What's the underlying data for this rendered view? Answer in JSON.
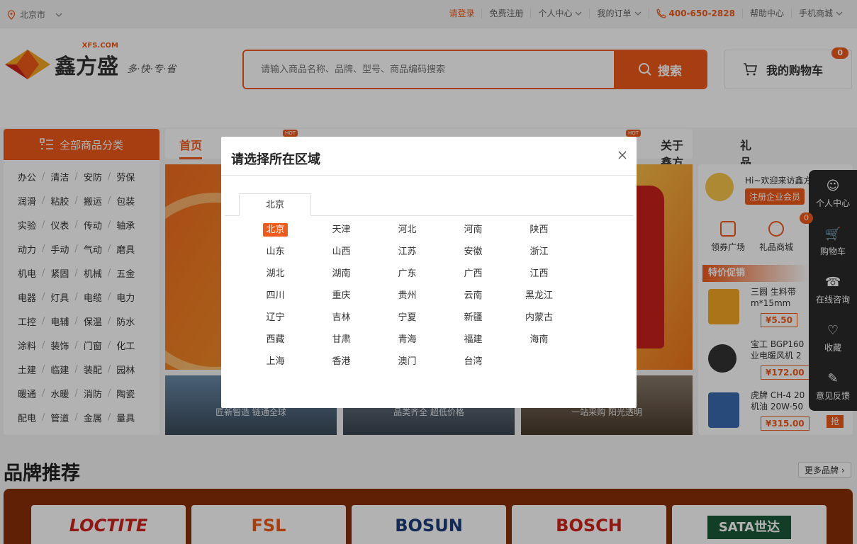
{
  "topbar": {
    "location": "北京市",
    "login": "请登录",
    "register": "免费注册",
    "user_center": "个人中心",
    "my_orders": "我的订单",
    "phone": "400-650-2828",
    "help": "帮助中心",
    "mobile": "手机商城"
  },
  "header": {
    "logo_text": "鑫方盛",
    "logo_domain": "XFS.COM",
    "slogan": "多·快·专·省",
    "search_placeholder": "请输入商品名称、品牌、型号、商品编码搜索",
    "search_button": "搜索",
    "cart_label": "我的购物车",
    "cart_count": "0"
  },
  "nav": {
    "all_categories": "全部商品分类",
    "home": "首页",
    "about": "关于鑫方盛",
    "gift": "礼品商城",
    "hot": "HOT"
  },
  "categories": [
    [
      "办公",
      "清洁",
      "安防",
      "劳保"
    ],
    [
      "润滑",
      "粘胶",
      "搬运",
      "包装"
    ],
    [
      "实验",
      "仪表",
      "传动",
      "轴承"
    ],
    [
      "动力",
      "手动",
      "气动",
      "磨具"
    ],
    [
      "机电",
      "紧固",
      "机械",
      "五金"
    ],
    [
      "电器",
      "灯具",
      "电缆",
      "电力"
    ],
    [
      "工控",
      "电辅",
      "保温",
      "防水"
    ],
    [
      "涂料",
      "装饰",
      "门窗",
      "化工"
    ],
    [
      "土建",
      "临建",
      "装配",
      "园林"
    ],
    [
      "暖通",
      "水暖",
      "消防",
      "陶瓷"
    ],
    [
      "配电",
      "管道",
      "金属",
      "量具"
    ]
  ],
  "tiles": [
    "匠新智造 链通全球",
    "品类齐全 超低价格",
    "一站采购 阳光透明"
  ],
  "user_panel": {
    "welcome": "Hi~欢迎来访鑫方盛",
    "register_btn": "注册企业会员",
    "coupon": "领券广场",
    "gift": "礼品商城",
    "promo_title": "特价促销",
    "products": [
      {
        "name": "三圆 生料带",
        "sub": "m*15mm",
        "price": "¥5.50"
      },
      {
        "name": "宝工 BGP160",
        "sub": "业电暖风机 2",
        "price": "¥172.00"
      },
      {
        "name": "虎牌 CH-4 20",
        "sub": "机油 20W-50",
        "price": "¥315.00"
      }
    ],
    "grab": "抢"
  },
  "sidebar": {
    "items": [
      "个人中心",
      "购物车",
      "在线咨询",
      "收藏",
      "意见反馈"
    ],
    "cart_badge": "0"
  },
  "brands": {
    "title": "品牌推荐",
    "more": "更多品牌",
    "names": [
      "LOCTITE",
      "FSL",
      "BOSUN",
      "BOSCH",
      "SATA世达"
    ]
  },
  "modal": {
    "title": "请选择所在区域",
    "tab": "北京",
    "selected": "北京",
    "cities": [
      "北京",
      "天津",
      "河北",
      "河南",
      "陕西",
      "山东",
      "山西",
      "江苏",
      "安徽",
      "浙江",
      "湖北",
      "湖南",
      "广东",
      "广西",
      "江西",
      "四川",
      "重庆",
      "贵州",
      "云南",
      "黑龙江",
      "辽宁",
      "吉林",
      "宁夏",
      "新疆",
      "内蒙古",
      "西藏",
      "甘肃",
      "青海",
      "福建",
      "海南",
      "上海",
      "香港",
      "澳门",
      "台湾"
    ]
  },
  "colors": {
    "accent": "#f05a1a",
    "sidebar": "#2a2a2a"
  }
}
